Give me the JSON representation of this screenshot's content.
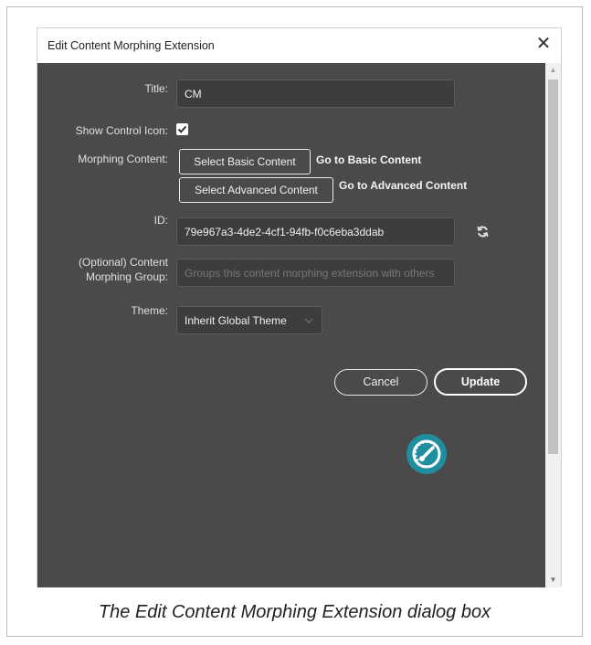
{
  "dialog": {
    "title": "Edit Content Morphing Extension",
    "close_symbol": "✕"
  },
  "form": {
    "title_label": "Title:",
    "title_value": "CM",
    "show_icon_label": "Show Control Icon:",
    "show_icon_checked": true,
    "morph_label": "Morphing Content:",
    "basic_button": "Select Basic Content",
    "basic_link": "Go to Basic Content",
    "advanced_button": "Select Advanced Content",
    "advanced_link": "Go to Advanced Content",
    "id_label": "ID:",
    "id_value": "79e967a3-4de2-4cf1-94fb-f0c6eba3ddab",
    "group_label_1": "(Optional) Content",
    "group_label_2": "Morphing Group:",
    "group_placeholder": "Groups this content morphing extension with others",
    "theme_label": "Theme:",
    "theme_value": "Inherit Global Theme"
  },
  "actions": {
    "cancel": "Cancel",
    "update": "Update"
  },
  "icons": {
    "refresh": "refresh-icon",
    "dropdown": "chevron-down-icon",
    "speedometer": "speedometer-icon",
    "close": "close-icon",
    "checkmark": "checkmark-icon"
  },
  "colors": {
    "panel_bg": "#4a4a4a",
    "accent_teal": "#1f8fa0"
  },
  "caption": "The Edit Content Morphing Extension dialog box"
}
